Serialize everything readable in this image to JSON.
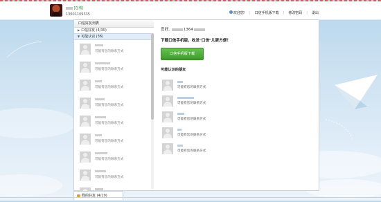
{
  "header": {
    "user_name_suffix": "",
    "status": "[在线]",
    "phone": "13601109335",
    "links": [
      "欢迎您!",
      "口信手机版下载",
      "修改密码",
      "退出"
    ]
  },
  "left_panel": {
    "title": "口信好友列表",
    "groups": [
      {
        "label": "口信好友 (4/30)",
        "expanded": false
      },
      {
        "label": "可能认识 (38)",
        "expanded": true
      }
    ],
    "contact_desc": "可能有您的联系方式",
    "contacts_count": 9
  },
  "main_panel": {
    "greeting_prefix": "您好,",
    "greeting_number": "1364",
    "download_text": "下载口信手机版，收发\"口信\"儿更方便！",
    "download_button": "口信手机版下载",
    "maybe_title": "可能认识的朋友",
    "friend_desc": "可能有您的联系方式",
    "friends_count": 5
  },
  "bottom_tab": {
    "label": "我的好友 (4/19)"
  },
  "colors": {
    "accent_green": "#4ead37",
    "sky": "#cfe3f2",
    "status_green": "#2e9a2e"
  }
}
